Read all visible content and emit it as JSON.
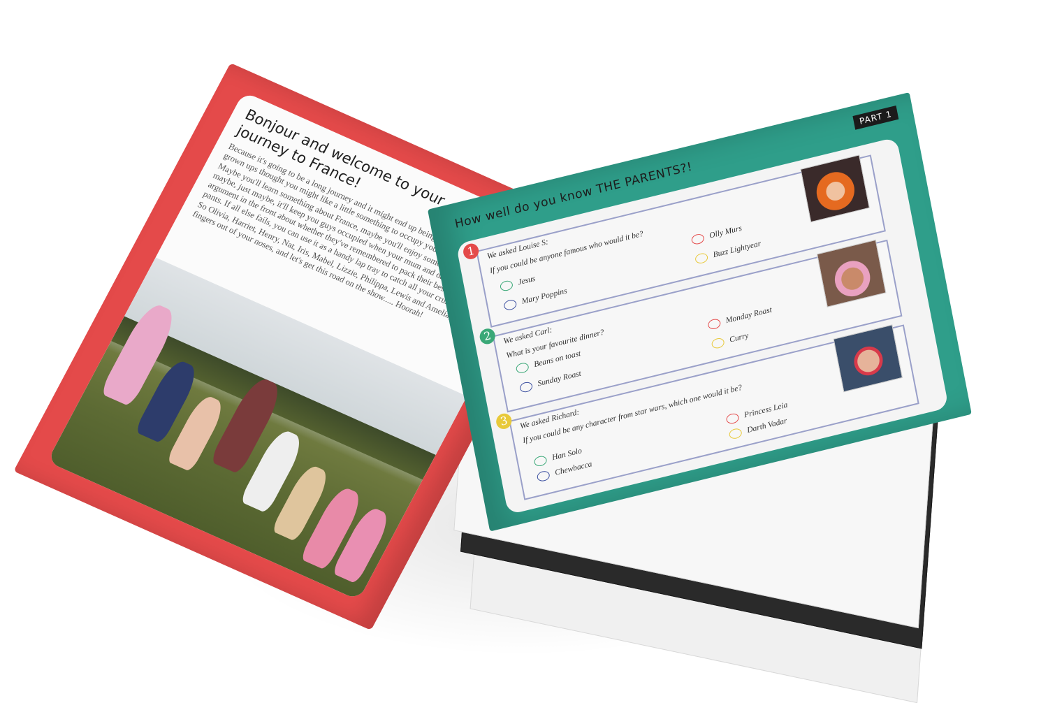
{
  "left_page": {
    "title_line1": "Bonjour and welcome to your",
    "title_line2": "journey to France!",
    "paragraphs": [
      "Because it's going to be a long journey and it might end up being really booooooring, us grown ups thought you might like a little something to occupy yourselves.",
      "Maybe you'll learn something about France, maybe you'll enjoy some colouring in, and maybe, just maybe, it'll keep you guys occupied when your mum and dad are having an argument in the front about whether they've remembered to pack their best green granny pants. If all else fails, you can use it as a handy lap tray to catch all your crumbs.",
      "So Olivia, Harriet, Henry, Nat, Iris, Mabel, Lizzie, Philippa, Lewis and Amelia, get your fingers out of your noses, and let's get this road on the show..... Hoorah!"
    ],
    "frame_color": "#e44a4a"
  },
  "right_page": {
    "part_tag": "PART 1",
    "title": "How well do you know THE PARENTS?!",
    "frame_color": "#2f9e8a",
    "questions": [
      {
        "number": "1",
        "number_color": "#e44a4a",
        "asked": "We asked Louise S:",
        "question": "If you could be anyone famous who would it be?",
        "options": [
          {
            "label": "Jesus",
            "ring_color": "#3aa877"
          },
          {
            "label": "Olly Murs",
            "ring_color": "#e44a4a"
          },
          {
            "label": "Mary Poppins",
            "ring_color": "#3b4fa0"
          },
          {
            "label": "Buzz Lightyear",
            "ring_color": "#e8c93a"
          }
        ]
      },
      {
        "number": "2",
        "number_color": "#3aa877",
        "asked": "We asked Carl:",
        "question": "What is your favourite dinner?",
        "options": [
          {
            "label": "Beans on toast",
            "ring_color": "#3aa877"
          },
          {
            "label": "Monday Roast",
            "ring_color": "#e44a4a"
          },
          {
            "label": "Sunday Roast",
            "ring_color": "#3b4fa0"
          },
          {
            "label": "Curry",
            "ring_color": "#e8c93a"
          }
        ]
      },
      {
        "number": "3",
        "number_color": "#e8c93a",
        "asked": "We asked Richard:",
        "question": "If you could be any character from star wars, which one would it be?",
        "options": [
          {
            "label": "Han Solo",
            "ring_color": "#3aa877"
          },
          {
            "label": "Princess Leia",
            "ring_color": "#e44a4a"
          },
          {
            "label": "Chewbacca",
            "ring_color": "#3b4fa0"
          },
          {
            "label": "Darth Vadar",
            "ring_color": "#e8c93a"
          }
        ]
      }
    ]
  }
}
